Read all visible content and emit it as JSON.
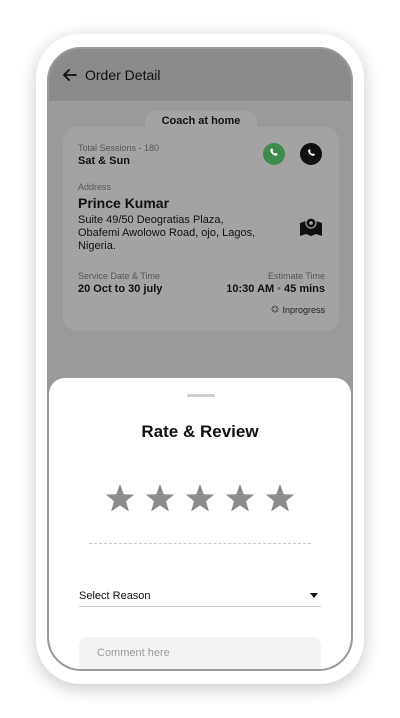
{
  "header": {
    "title": "Order Detail"
  },
  "order": {
    "tab_label": "Coach at home",
    "sessions_label": "Total Sessions - 180",
    "sessions_value": "Sat & Sun",
    "address_label": "Address",
    "address_name": "Prince Kumar",
    "address_line1": "Suite 49/50 Deogratias Plaza,",
    "address_line2": "Obafemi Awolowo Road, ojo, Lagos,",
    "address_line3": "Nigeria.",
    "service_date_label": "Service Date & Time",
    "service_date_value": "20 Oct to 30 july",
    "estimate_label": "Estimate Time",
    "estimate_time": "10:30 AM",
    "estimate_duration": "45 mins",
    "status": "Inprogress"
  },
  "review": {
    "title": "Rate & Review",
    "rating": 0,
    "max_rating": 5,
    "select_reason": "Select Reason",
    "comment_placeholder": "Comment here"
  },
  "colors": {
    "whatsapp": "#3e8c4b",
    "star": "#8c8c8c",
    "overlay": "#8d8d8d"
  },
  "icons": [
    "back-arrow-icon",
    "whatsapp-icon",
    "phone-icon",
    "map-icon",
    "spinner-icon",
    "star-icon",
    "chevron-down-icon"
  ]
}
